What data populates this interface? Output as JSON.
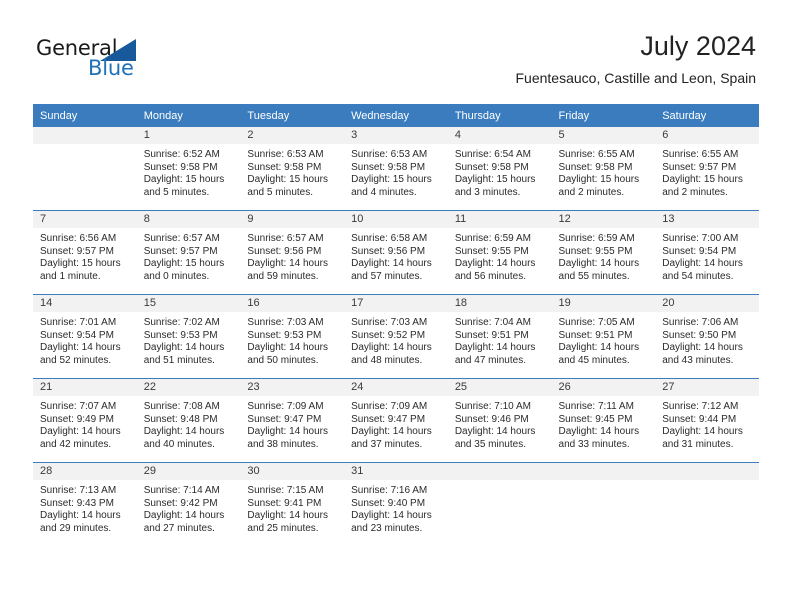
{
  "brand": {
    "name_part1": "General",
    "name_part2": "Blue",
    "accent_color": "#2072b8",
    "triangle_color": "#17599b"
  },
  "header": {
    "title": "July 2024",
    "subtitle": "Fuentesauco, Castille and Leon, Spain"
  },
  "calendar": {
    "header_bg": "#3a7cbe",
    "daynum_bg": "#f2f2f2",
    "weekdays": [
      "Sunday",
      "Monday",
      "Tuesday",
      "Wednesday",
      "Thursday",
      "Friday",
      "Saturday"
    ],
    "weeks": [
      [
        {
          "day": "",
          "sunrise": "",
          "sunset": "",
          "daylight_line1": "",
          "daylight_line2": ""
        },
        {
          "day": "1",
          "sunrise": "Sunrise: 6:52 AM",
          "sunset": "Sunset: 9:58 PM",
          "daylight_line1": "Daylight: 15 hours",
          "daylight_line2": "and 5 minutes."
        },
        {
          "day": "2",
          "sunrise": "Sunrise: 6:53 AM",
          "sunset": "Sunset: 9:58 PM",
          "daylight_line1": "Daylight: 15 hours",
          "daylight_line2": "and 5 minutes."
        },
        {
          "day": "3",
          "sunrise": "Sunrise: 6:53 AM",
          "sunset": "Sunset: 9:58 PM",
          "daylight_line1": "Daylight: 15 hours",
          "daylight_line2": "and 4 minutes."
        },
        {
          "day": "4",
          "sunrise": "Sunrise: 6:54 AM",
          "sunset": "Sunset: 9:58 PM",
          "daylight_line1": "Daylight: 15 hours",
          "daylight_line2": "and 3 minutes."
        },
        {
          "day": "5",
          "sunrise": "Sunrise: 6:55 AM",
          "sunset": "Sunset: 9:58 PM",
          "daylight_line1": "Daylight: 15 hours",
          "daylight_line2": "and 2 minutes."
        },
        {
          "day": "6",
          "sunrise": "Sunrise: 6:55 AM",
          "sunset": "Sunset: 9:57 PM",
          "daylight_line1": "Daylight: 15 hours",
          "daylight_line2": "and 2 minutes."
        }
      ],
      [
        {
          "day": "7",
          "sunrise": "Sunrise: 6:56 AM",
          "sunset": "Sunset: 9:57 PM",
          "daylight_line1": "Daylight: 15 hours",
          "daylight_line2": "and 1 minute."
        },
        {
          "day": "8",
          "sunrise": "Sunrise: 6:57 AM",
          "sunset": "Sunset: 9:57 PM",
          "daylight_line1": "Daylight: 15 hours",
          "daylight_line2": "and 0 minutes."
        },
        {
          "day": "9",
          "sunrise": "Sunrise: 6:57 AM",
          "sunset": "Sunset: 9:56 PM",
          "daylight_line1": "Daylight: 14 hours",
          "daylight_line2": "and 59 minutes."
        },
        {
          "day": "10",
          "sunrise": "Sunrise: 6:58 AM",
          "sunset": "Sunset: 9:56 PM",
          "daylight_line1": "Daylight: 14 hours",
          "daylight_line2": "and 57 minutes."
        },
        {
          "day": "11",
          "sunrise": "Sunrise: 6:59 AM",
          "sunset": "Sunset: 9:55 PM",
          "daylight_line1": "Daylight: 14 hours",
          "daylight_line2": "and 56 minutes."
        },
        {
          "day": "12",
          "sunrise": "Sunrise: 6:59 AM",
          "sunset": "Sunset: 9:55 PM",
          "daylight_line1": "Daylight: 14 hours",
          "daylight_line2": "and 55 minutes."
        },
        {
          "day": "13",
          "sunrise": "Sunrise: 7:00 AM",
          "sunset": "Sunset: 9:54 PM",
          "daylight_line1": "Daylight: 14 hours",
          "daylight_line2": "and 54 minutes."
        }
      ],
      [
        {
          "day": "14",
          "sunrise": "Sunrise: 7:01 AM",
          "sunset": "Sunset: 9:54 PM",
          "daylight_line1": "Daylight: 14 hours",
          "daylight_line2": "and 52 minutes."
        },
        {
          "day": "15",
          "sunrise": "Sunrise: 7:02 AM",
          "sunset": "Sunset: 9:53 PM",
          "daylight_line1": "Daylight: 14 hours",
          "daylight_line2": "and 51 minutes."
        },
        {
          "day": "16",
          "sunrise": "Sunrise: 7:03 AM",
          "sunset": "Sunset: 9:53 PM",
          "daylight_line1": "Daylight: 14 hours",
          "daylight_line2": "and 50 minutes."
        },
        {
          "day": "17",
          "sunrise": "Sunrise: 7:03 AM",
          "sunset": "Sunset: 9:52 PM",
          "daylight_line1": "Daylight: 14 hours",
          "daylight_line2": "and 48 minutes."
        },
        {
          "day": "18",
          "sunrise": "Sunrise: 7:04 AM",
          "sunset": "Sunset: 9:51 PM",
          "daylight_line1": "Daylight: 14 hours",
          "daylight_line2": "and 47 minutes."
        },
        {
          "day": "19",
          "sunrise": "Sunrise: 7:05 AM",
          "sunset": "Sunset: 9:51 PM",
          "daylight_line1": "Daylight: 14 hours",
          "daylight_line2": "and 45 minutes."
        },
        {
          "day": "20",
          "sunrise": "Sunrise: 7:06 AM",
          "sunset": "Sunset: 9:50 PM",
          "daylight_line1": "Daylight: 14 hours",
          "daylight_line2": "and 43 minutes."
        }
      ],
      [
        {
          "day": "21",
          "sunrise": "Sunrise: 7:07 AM",
          "sunset": "Sunset: 9:49 PM",
          "daylight_line1": "Daylight: 14 hours",
          "daylight_line2": "and 42 minutes."
        },
        {
          "day": "22",
          "sunrise": "Sunrise: 7:08 AM",
          "sunset": "Sunset: 9:48 PM",
          "daylight_line1": "Daylight: 14 hours",
          "daylight_line2": "and 40 minutes."
        },
        {
          "day": "23",
          "sunrise": "Sunrise: 7:09 AM",
          "sunset": "Sunset: 9:47 PM",
          "daylight_line1": "Daylight: 14 hours",
          "daylight_line2": "and 38 minutes."
        },
        {
          "day": "24",
          "sunrise": "Sunrise: 7:09 AM",
          "sunset": "Sunset: 9:47 PM",
          "daylight_line1": "Daylight: 14 hours",
          "daylight_line2": "and 37 minutes."
        },
        {
          "day": "25",
          "sunrise": "Sunrise: 7:10 AM",
          "sunset": "Sunset: 9:46 PM",
          "daylight_line1": "Daylight: 14 hours",
          "daylight_line2": "and 35 minutes."
        },
        {
          "day": "26",
          "sunrise": "Sunrise: 7:11 AM",
          "sunset": "Sunset: 9:45 PM",
          "daylight_line1": "Daylight: 14 hours",
          "daylight_line2": "and 33 minutes."
        },
        {
          "day": "27",
          "sunrise": "Sunrise: 7:12 AM",
          "sunset": "Sunset: 9:44 PM",
          "daylight_line1": "Daylight: 14 hours",
          "daylight_line2": "and 31 minutes."
        }
      ],
      [
        {
          "day": "28",
          "sunrise": "Sunrise: 7:13 AM",
          "sunset": "Sunset: 9:43 PM",
          "daylight_line1": "Daylight: 14 hours",
          "daylight_line2": "and 29 minutes."
        },
        {
          "day": "29",
          "sunrise": "Sunrise: 7:14 AM",
          "sunset": "Sunset: 9:42 PM",
          "daylight_line1": "Daylight: 14 hours",
          "daylight_line2": "and 27 minutes."
        },
        {
          "day": "30",
          "sunrise": "Sunrise: 7:15 AM",
          "sunset": "Sunset: 9:41 PM",
          "daylight_line1": "Daylight: 14 hours",
          "daylight_line2": "and 25 minutes."
        },
        {
          "day": "31",
          "sunrise": "Sunrise: 7:16 AM",
          "sunset": "Sunset: 9:40 PM",
          "daylight_line1": "Daylight: 14 hours",
          "daylight_line2": "and 23 minutes."
        },
        {
          "day": "",
          "sunrise": "",
          "sunset": "",
          "daylight_line1": "",
          "daylight_line2": ""
        },
        {
          "day": "",
          "sunrise": "",
          "sunset": "",
          "daylight_line1": "",
          "daylight_line2": ""
        },
        {
          "day": "",
          "sunrise": "",
          "sunset": "",
          "daylight_line1": "",
          "daylight_line2": ""
        }
      ]
    ]
  }
}
